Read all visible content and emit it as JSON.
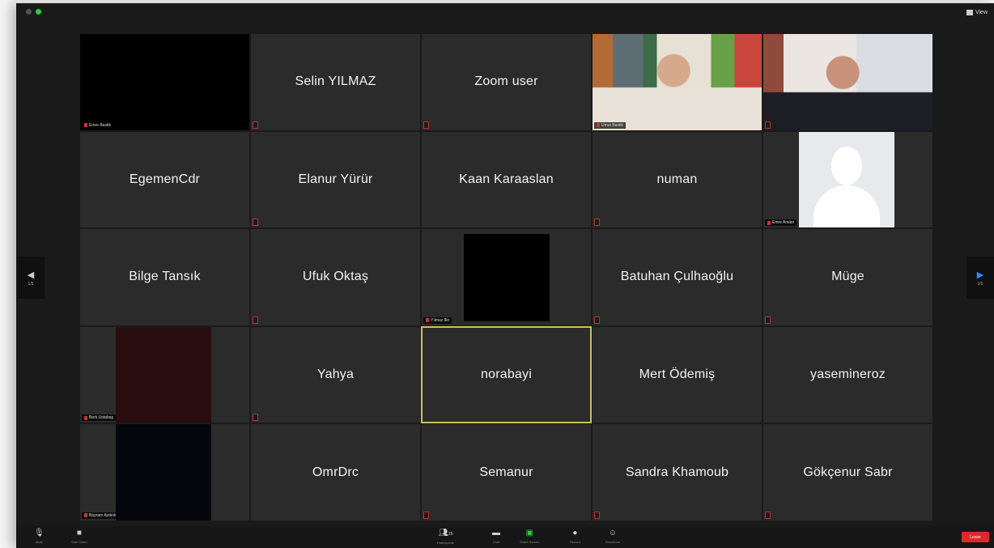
{
  "window": {
    "view_button": "View"
  },
  "participants": [
    {
      "name": "",
      "tag": "Emre Bastik",
      "kind": "black"
    },
    {
      "name": "Selin YILMAZ",
      "kind": "name"
    },
    {
      "name": "Zoom user",
      "kind": "name"
    },
    {
      "name": "",
      "tag": "Umut Bastik",
      "kind": "video1"
    },
    {
      "name": "",
      "tag": "",
      "kind": "video2"
    },
    {
      "name": "EgemenCdr",
      "kind": "name"
    },
    {
      "name": "Elanur Yürür",
      "kind": "name"
    },
    {
      "name": "Kaan Karaaslan",
      "kind": "name"
    },
    {
      "name": "numan",
      "kind": "name"
    },
    {
      "name": "",
      "tag": "Emre Arslan",
      "kind": "avatar"
    },
    {
      "name": "Bilge Tansık",
      "kind": "name"
    },
    {
      "name": "Ufuk Oktaş",
      "kind": "name"
    },
    {
      "name": "",
      "tag": "Yılmaz Ilkr",
      "kind": "blackcenter"
    },
    {
      "name": "Batuhan Çulhaoğlu",
      "kind": "name"
    },
    {
      "name": "Müge",
      "kind": "name"
    },
    {
      "name": "",
      "tag": "Berk Ustabaş",
      "kind": "maroon"
    },
    {
      "name": "Yahya",
      "kind": "name"
    },
    {
      "name": "norabayi",
      "kind": "name",
      "active": true
    },
    {
      "name": "Mert Ödemiş",
      "kind": "name"
    },
    {
      "name": "yasemineroz",
      "kind": "name"
    },
    {
      "name": "",
      "tag": "Bayram Aydınlı",
      "kind": "navy"
    },
    {
      "name": "OmrDrc",
      "kind": "name"
    },
    {
      "name": "Semanur",
      "kind": "name"
    },
    {
      "name": "Sandra Khamoub",
      "kind": "name"
    },
    {
      "name": "Gökçenur Sabr",
      "kind": "name"
    }
  ],
  "nav": {
    "left_page": "1/5",
    "right_page": "1/5"
  },
  "toolbar": {
    "mute": "Mute",
    "video": "Start Video",
    "participants": "Participants",
    "participants_count": "25",
    "chat": "Chat",
    "share": "Share Screen",
    "record": "Record",
    "reactions": "Reactions",
    "end": "Leave"
  }
}
